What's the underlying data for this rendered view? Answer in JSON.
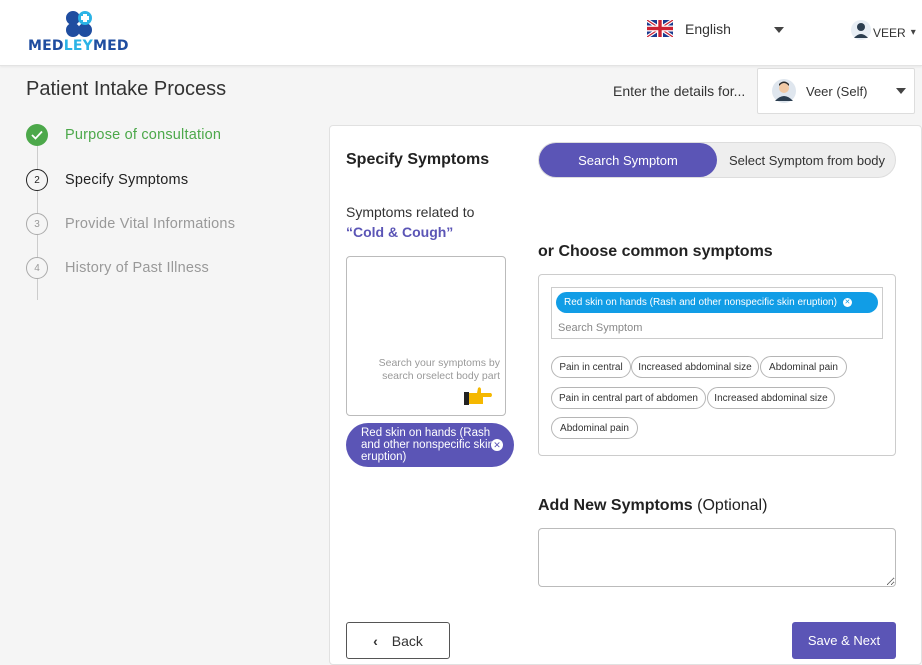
{
  "app": {
    "logo_prefix": "MED",
    "logo_mid": "LEY",
    "logo_suffix": "MED"
  },
  "header": {
    "language": "English",
    "user": "VEER"
  },
  "page": {
    "title": "Patient Intake Process",
    "details_label": "Enter the details for...",
    "profile": "Veer (Self)"
  },
  "steps": [
    {
      "label": "Purpose of consultation",
      "state": "done",
      "color": "#4ca84a"
    },
    {
      "label": "Specify Symptoms",
      "number": "2",
      "state": "active"
    },
    {
      "label": "Provide Vital Informations",
      "number": "3",
      "state": "pending"
    },
    {
      "label": "History of Past Illness",
      "number": "4",
      "state": "pending"
    }
  ],
  "specify": {
    "title": "Specify Symptoms",
    "toggle_on": "Search Symptom",
    "toggle_off": "Select Symptom from body",
    "related_label": "Symptoms related to",
    "related_topic": "“Cold & Cough”",
    "body_hint": "Search your symptoms by search orselect body part",
    "selected_chip": "Red skin on hands (Rash and other nonspecific skin eruption)"
  },
  "common": {
    "title": "or Choose common symptoms",
    "selected": "Red skin on hands (Rash and other nonspecific skin eruption)",
    "search_placeholder": "Search Symptom",
    "tags": [
      "Pain in central",
      "Increased abdominal size",
      "Abdominal pain",
      "Pain in central part of abdomen",
      "Increased abdominal size",
      "Abdominal pain"
    ]
  },
  "add_new": {
    "title": "Add New Symptoms",
    "optional": "(Optional)"
  },
  "buttons": {
    "back": "Back",
    "next": "Save & Next"
  },
  "colors": {
    "primary": "#5b55b6",
    "chip_blue": "#119de6",
    "done_green": "#4ca84a"
  },
  "icons": [
    "medleymed-logo-icon",
    "uk-flag-icon",
    "user-avatar-icon",
    "checkmark-icon",
    "pointing-hand-icon",
    "close-icon",
    "chevron-left-icon",
    "caret-down-icon"
  ]
}
